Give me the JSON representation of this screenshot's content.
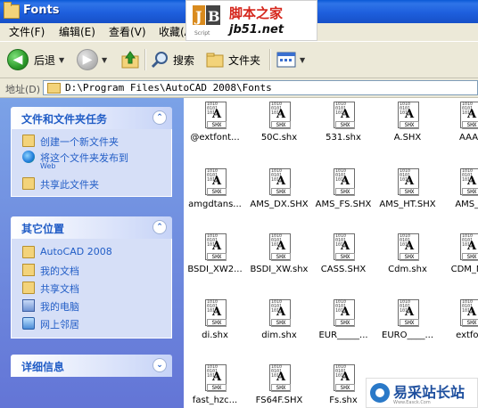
{
  "window": {
    "title": "Fonts"
  },
  "watermark_top": {
    "line1": "脚本之家",
    "line2": "jb51.net",
    "logo_text": "Script"
  },
  "watermark_bottom": {
    "text": "易采站长站",
    "sub": "Www.Easck.Com"
  },
  "menu": [
    {
      "label": "文件(F)"
    },
    {
      "label": "编辑(E)"
    },
    {
      "label": "查看(V)"
    },
    {
      "label": "收藏(A)"
    }
  ],
  "toolbar": {
    "back": "后退",
    "search": "搜索",
    "folders": "文件夹"
  },
  "address": {
    "label": "地址(D)",
    "value": "D:\\Program Files\\AutoCAD 2008\\Fonts"
  },
  "panels": {
    "tasks": {
      "title": "文件和文件夹任务",
      "items": [
        {
          "label": "创建一个新文件夹",
          "icon": "new-folder-icon"
        },
        {
          "label": "将这个文件夹发布到",
          "sub": "Web",
          "icon": "publish-web-icon"
        },
        {
          "label": "共享此文件夹",
          "icon": "share-folder-icon"
        }
      ]
    },
    "places": {
      "title": "其它位置",
      "items": [
        {
          "label": "AutoCAD 2008",
          "icon": "folder-icon"
        },
        {
          "label": "我的文档",
          "icon": "my-documents-icon"
        },
        {
          "label": "共享文档",
          "icon": "shared-documents-icon"
        },
        {
          "label": "我的电脑",
          "icon": "my-computer-icon"
        },
        {
          "label": "网上邻居",
          "icon": "network-icon"
        }
      ]
    },
    "details": {
      "title": "详细信息"
    }
  },
  "files": [
    [
      "@extfont...",
      "50C.shx",
      "531.shx",
      "A.SHX",
      "AAA."
    ],
    [
      "amgdtans...",
      "AMS_DX.SHX",
      "AMS_FS.SHX",
      "AMS_HT.SHX",
      "AMS_K"
    ],
    [
      "BSDI_XW2...",
      "BSDI_XW.shx",
      "CASS.SHX",
      "Cdm.shx",
      "CDM_NC"
    ],
    [
      "di.shx",
      "dim.shx",
      "EUR_____...",
      "EURO____...",
      "extfon"
    ],
    [
      "fast_hzc...",
      "FS64F.SHX",
      "Fs.shx",
      "",
      ""
    ]
  ],
  "file_icon": {
    "bits": "1010\n0101\n1010",
    "letter": "A",
    "label": "SHX"
  }
}
